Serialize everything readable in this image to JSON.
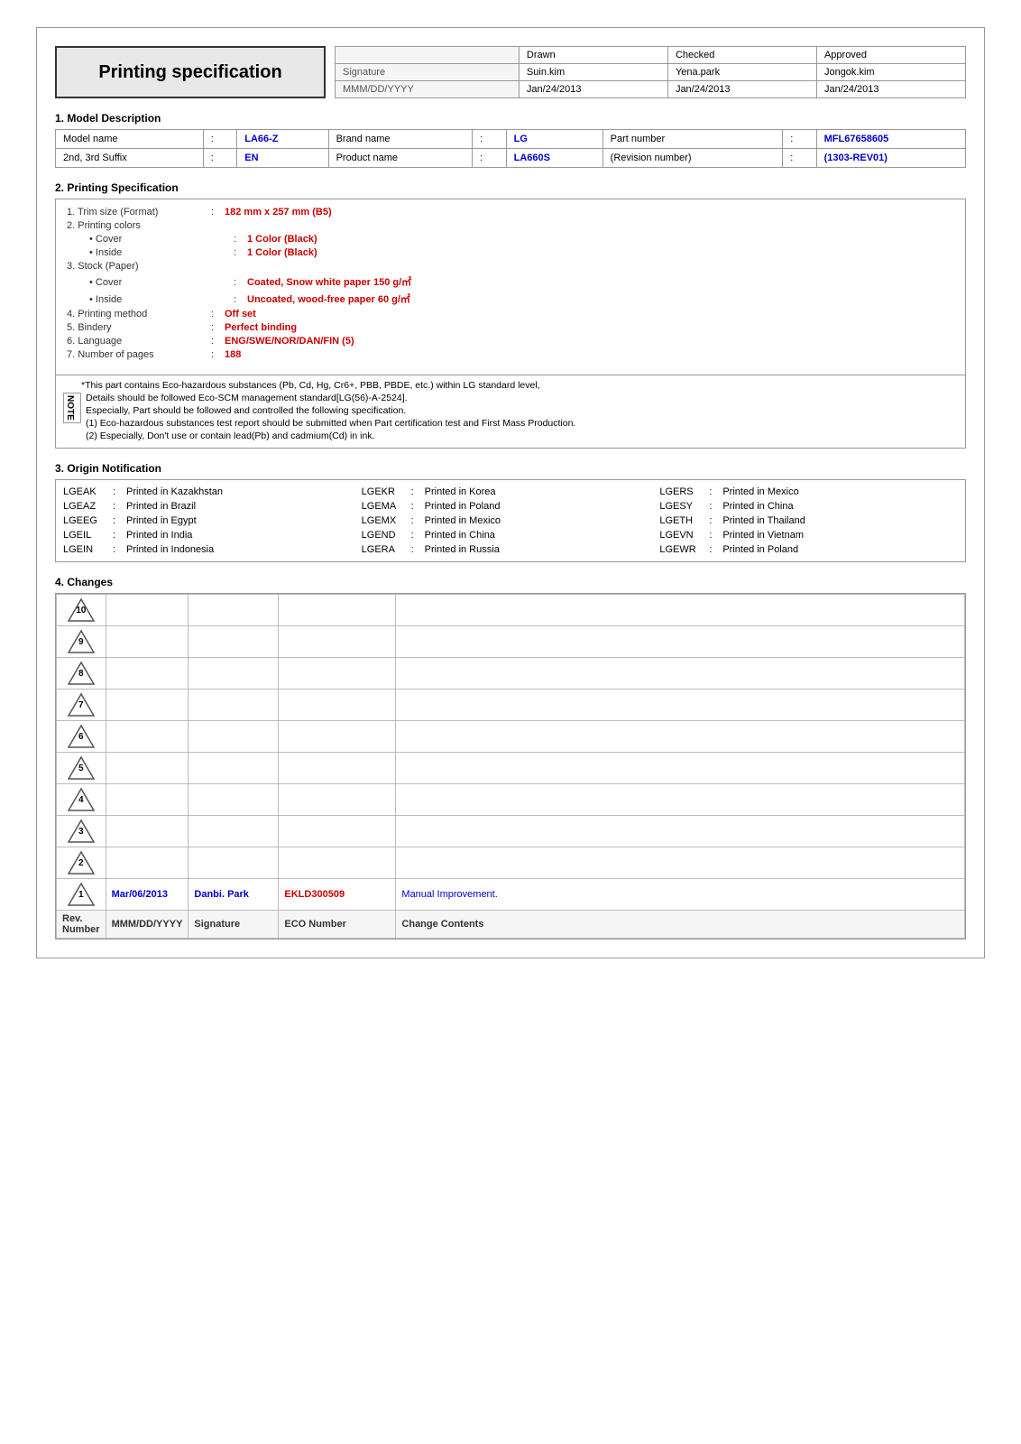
{
  "header": {
    "title": "Printing specification",
    "table": {
      "columns": [
        "",
        "Drawn",
        "Checked",
        "Approved"
      ],
      "rows": [
        [
          "Signature",
          "Suin.kim",
          "Yena.park",
          "Jongok.kim"
        ],
        [
          "MMM/DD/YYYY",
          "Jan/24/2013",
          "Jan/24/2013",
          "Jan/24/2013"
        ]
      ]
    }
  },
  "section1": {
    "title": "1. Model Description",
    "rows": [
      {
        "cells": [
          {
            "label": "Model name",
            "colon": ":",
            "value": "LA66-Z",
            "is_highlight": true
          },
          {
            "label": "Brand name",
            "colon": ":",
            "value": "LG",
            "is_highlight": true
          },
          {
            "label": "Part number",
            "colon": ":",
            "value": "MFL67658605",
            "is_highlight": true
          }
        ]
      },
      {
        "cells": [
          {
            "label": "2nd, 3rd Suffix",
            "colon": ":",
            "value": "EN",
            "is_highlight": true
          },
          {
            "label": "Product name",
            "colon": ":",
            "value": "LA660S",
            "is_highlight": true
          },
          {
            "label": "(Revision number)",
            "colon": ":",
            "value": "(1303-REV01)",
            "is_highlight": true
          }
        ]
      }
    ]
  },
  "section2": {
    "title": "2. Printing Specification",
    "items": [
      {
        "num": "1.",
        "label": "Trim size (Format)",
        "colon": ":",
        "value": "182 mm x 257 mm (B5)",
        "indent": 0
      },
      {
        "num": "2.",
        "label": "Printing colors",
        "colon": "",
        "value": "",
        "indent": 0
      },
      {
        "num": "",
        "label": "• Cover",
        "colon": ":",
        "value": "1 Color (Black)",
        "indent": 1
      },
      {
        "num": "",
        "label": "• Inside",
        "colon": ":",
        "value": "1 Color (Black)",
        "indent": 1
      },
      {
        "num": "3.",
        "label": "Stock (Paper)",
        "colon": "",
        "value": "",
        "indent": 0
      },
      {
        "num": "",
        "label": "• Cover",
        "colon": ":",
        "value": "Coated, Snow white paper 150 g/㎡",
        "indent": 1
      },
      {
        "num": "",
        "label": "• Inside",
        "colon": ":",
        "value": "Uncoated, wood-free paper 60 g/㎡",
        "indent": 1
      },
      {
        "num": "4.",
        "label": "Printing method",
        "colon": ":",
        "value": "Off set",
        "indent": 0
      },
      {
        "num": "5.",
        "label": "Bindery",
        "colon": ":",
        "value": "Perfect binding",
        "indent": 0
      },
      {
        "num": "6.",
        "label": "Language",
        "colon": ":",
        "value": "ENG/SWE/NOR/DAN/FIN (5)",
        "indent": 0
      },
      {
        "num": "7.",
        "label": "Number of pages",
        "colon": ":",
        "value": "188",
        "indent": 0
      }
    ],
    "notes": [
      {
        "left": "",
        "text": "*This part contains Eco-hazardous substances (Pb, Cd, Hg, Cr6+, PBB, PBDE, etc.) within LG standard level,"
      },
      {
        "left": "N\nO\nT\nE",
        "text": "Details should be followed Eco-SCM management standard[LG(56)-A-2524]."
      },
      {
        "left": "",
        "text": "Especially, Part should be followed and controlled the following specification."
      },
      {
        "left": "",
        "text": "(1) Eco-hazardous substances test report should be submitted when Part certification test and First Mass Production."
      },
      {
        "left": "",
        "text": "(2) Especially, Don't use or contain lead(Pb) and cadmium(Cd) in ink."
      }
    ]
  },
  "section3": {
    "title": "3. Origin Notification",
    "entries": [
      {
        "code": "LGEAK",
        "colon": ":",
        "text": "Printed in Kazakhstan"
      },
      {
        "code": "LGEKR",
        "colon": ":",
        "text": "Printed in Korea"
      },
      {
        "code": "LGERS",
        "colon": ":",
        "text": "Printed in Mexico"
      },
      {
        "code": "LGEAZ",
        "colon": ":",
        "text": "Printed in Brazil"
      },
      {
        "code": "LGEMA",
        "colon": ":",
        "text": "Printed in Poland"
      },
      {
        "code": "LGESY",
        "colon": ":",
        "text": "Printed in China"
      },
      {
        "code": "LGEEG",
        "colon": ":",
        "text": "Printed in Egypt"
      },
      {
        "code": "LGEMX",
        "colon": ":",
        "text": "Printed in Mexico"
      },
      {
        "code": "LGETH",
        "colon": ":",
        "text": "Printed in Thailand"
      },
      {
        "code": "LGEIL",
        "colon": ":",
        "text": "Printed in India"
      },
      {
        "code": "LGEND",
        "colon": ":",
        "text": "Printed in China"
      },
      {
        "code": "LGEVN",
        "colon": ":",
        "text": "Printed in Vietnam"
      },
      {
        "code": "LGEIN",
        "colon": ":",
        "text": "Printed in Indonesia"
      },
      {
        "code": "LGERA",
        "colon": ":",
        "text": "Printed in Russia"
      },
      {
        "code": "LGEWR",
        "colon": ":",
        "text": "Printed in Poland"
      }
    ]
  },
  "section4": {
    "title": "4. Changes",
    "rows": [
      {
        "rev": "10",
        "date": "",
        "sig": "",
        "eco": "",
        "change": ""
      },
      {
        "rev": "9",
        "date": "",
        "sig": "",
        "eco": "",
        "change": ""
      },
      {
        "rev": "8",
        "date": "",
        "sig": "",
        "eco": "",
        "change": ""
      },
      {
        "rev": "7",
        "date": "",
        "sig": "",
        "eco": "",
        "change": ""
      },
      {
        "rev": "6",
        "date": "",
        "sig": "",
        "eco": "",
        "change": ""
      },
      {
        "rev": "5",
        "date": "",
        "sig": "",
        "eco": "",
        "change": ""
      },
      {
        "rev": "4",
        "date": "",
        "sig": "",
        "eco": "",
        "change": ""
      },
      {
        "rev": "3",
        "date": "",
        "sig": "",
        "eco": "",
        "change": ""
      },
      {
        "rev": "2",
        "date": "",
        "sig": "",
        "eco": "",
        "change": ""
      },
      {
        "rev": "1",
        "date": "Mar/06/2013",
        "sig": "Danbi. Park",
        "eco": "EKLD300509",
        "change": "Manual Improvement."
      }
    ],
    "footer": {
      "col1": "Rev. Number",
      "col2": "MMM/DD/YYYY",
      "col3": "Signature",
      "col4": "ECO Number",
      "col5": "Change Contents"
    }
  }
}
